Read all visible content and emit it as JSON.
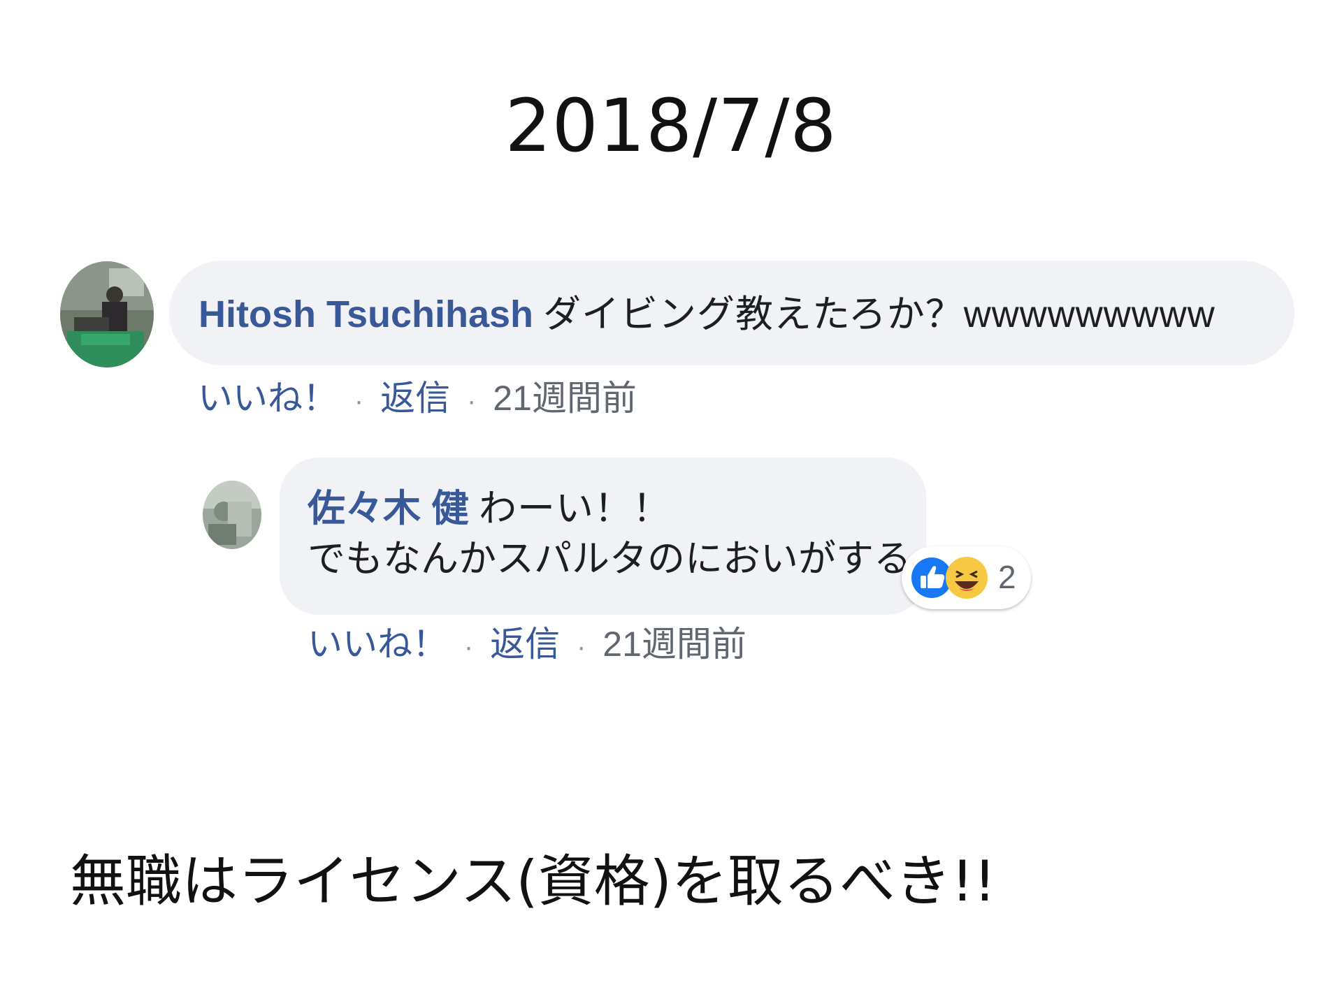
{
  "slide": {
    "title": "2018/7/8",
    "footer": "無職はライセンス(資格)を取るべき!!"
  },
  "comment": {
    "author": "Hitosh Tsuchihash",
    "text": "ダイビング教えたろか？wwwwwwwww",
    "actions": {
      "like": "いいね！",
      "separator": "·",
      "reply": "返信",
      "time": "21週間前"
    }
  },
  "reply": {
    "author": "佐々木 健",
    "text_line1": "わーい！！",
    "text_line2": "でもなんかスパルタのにおいがする",
    "reactions": {
      "icons": [
        "like-icon",
        "haha-icon"
      ],
      "count": "2"
    },
    "actions": {
      "like": "いいね！",
      "separator": "·",
      "reply": "返信",
      "time": "21週間前"
    }
  },
  "colors": {
    "author_name": "#385898",
    "bubble_bg": "#f1f2f6",
    "meta_gray": "#606770",
    "like_blue": "#1877f2",
    "haha_yellow": "#f7c844"
  }
}
